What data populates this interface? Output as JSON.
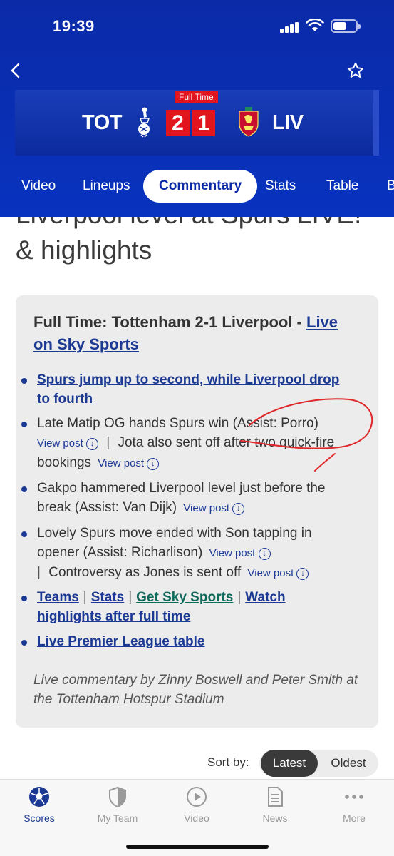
{
  "status": {
    "time": "19:39"
  },
  "match": {
    "status_badge": "Full Time",
    "home": {
      "abbr": "TOT",
      "score": "2"
    },
    "away": {
      "abbr": "LIV",
      "score": "1"
    }
  },
  "tabs": [
    {
      "label": "Video"
    },
    {
      "label": "Lineups"
    },
    {
      "label": "Commentary"
    },
    {
      "label": "Stats"
    },
    {
      "label": "Table"
    },
    {
      "label": "B"
    }
  ],
  "article": {
    "title_partial": "Liverpool level at Spurs LIVE!",
    "title_end": "& highlights"
  },
  "summary": {
    "headline": "Full Time: Tottenham 2-1 Liverpool -",
    "headline_link": "Live on Sky Sports",
    "view_post": "View post",
    "bullet1_link": "Spurs jump up to second, while Liverpool drop to fourth",
    "bullet2_text_a": "Late Matip OG hands Spurs win (Assist: Porro)",
    "bullet2_text_b": "Jota also sent off after two quick-fire bookings",
    "bullet3_text": "Gakpo hammered Liverpool level just before the break (Assist: Van Dijk)",
    "bullet4_text_a": "Lovely Spurs move ended with Son tapping in opener (Assist: Richarlison)",
    "bullet4_text_b": "Controversy as Jones is sent off",
    "link_teams": "Teams",
    "link_stats": "Stats",
    "link_sky": "Get Sky Sports",
    "link_watch": "Watch highlights after full time",
    "link_table": "Live Premier League table",
    "credit": "Live commentary by Zinny Boswell and Peter Smith at the Tottenham Hotspur Stadium"
  },
  "sort": {
    "label": "Sort by:",
    "options": [
      "Latest",
      "Oldest"
    ],
    "selected": "Latest"
  },
  "bottom_nav": [
    {
      "label": "Scores",
      "icon": "football-icon"
    },
    {
      "label": "My Team",
      "icon": "shield-icon"
    },
    {
      "label": "Video",
      "icon": "play-icon"
    },
    {
      "label": "News",
      "icon": "document-icon"
    },
    {
      "label": "More",
      "icon": "more-dots-icon"
    }
  ],
  "colors": {
    "header_blue": "#0a2aa8",
    "score_red": "#e2141e",
    "link_blue": "#1c3a94",
    "annotation_red": "#e0282a"
  }
}
